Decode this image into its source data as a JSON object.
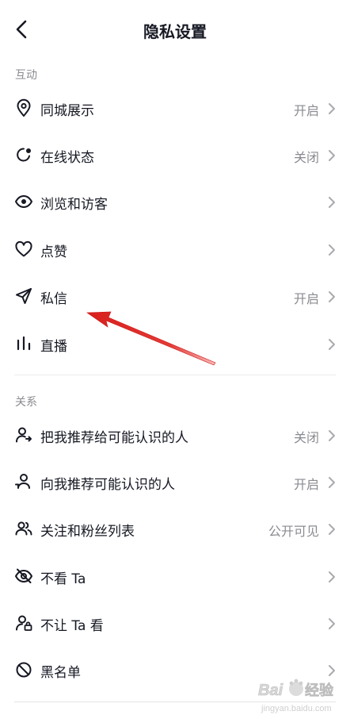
{
  "header": {
    "title": "隐私设置",
    "back_icon": "chevron-left-icon"
  },
  "sections": [
    {
      "title": "互动",
      "items": [
        {
          "label": "同城展示",
          "value": "开启",
          "icon": "location-pin-icon"
        },
        {
          "label": "在线状态",
          "value": "关闭",
          "icon": "online-status-icon"
        },
        {
          "label": "浏览和访客",
          "value": "",
          "icon": "eye-icon"
        },
        {
          "label": "点赞",
          "value": "",
          "icon": "heart-icon"
        },
        {
          "label": "私信",
          "value": "开启",
          "icon": "paper-plane-icon"
        },
        {
          "label": "直播",
          "value": "",
          "icon": "live-bars-icon"
        }
      ]
    },
    {
      "title": "关系",
      "items": [
        {
          "label": "把我推荐给可能认识的人",
          "value": "关闭",
          "icon": "user-share-icon"
        },
        {
          "label": "向我推荐可能认识的人",
          "value": "开启",
          "icon": "user-recommend-icon"
        },
        {
          "label": "关注和粉丝列表",
          "value": "公开可见",
          "icon": "users-icon"
        },
        {
          "label": "不看 Ta",
          "value": "",
          "icon": "eye-off-icon"
        },
        {
          "label": "不让 Ta 看",
          "value": "",
          "icon": "user-lock-icon"
        },
        {
          "label": "黑名单",
          "value": "",
          "icon": "block-icon"
        }
      ]
    }
  ],
  "colors": {
    "text": "#161823",
    "secondary": "#8a8b91",
    "annotation_arrow": "#e0201f"
  },
  "watermark": {
    "brand": "Baidu",
    "site": "jingyan.baidu.com",
    "text": "经验"
  }
}
